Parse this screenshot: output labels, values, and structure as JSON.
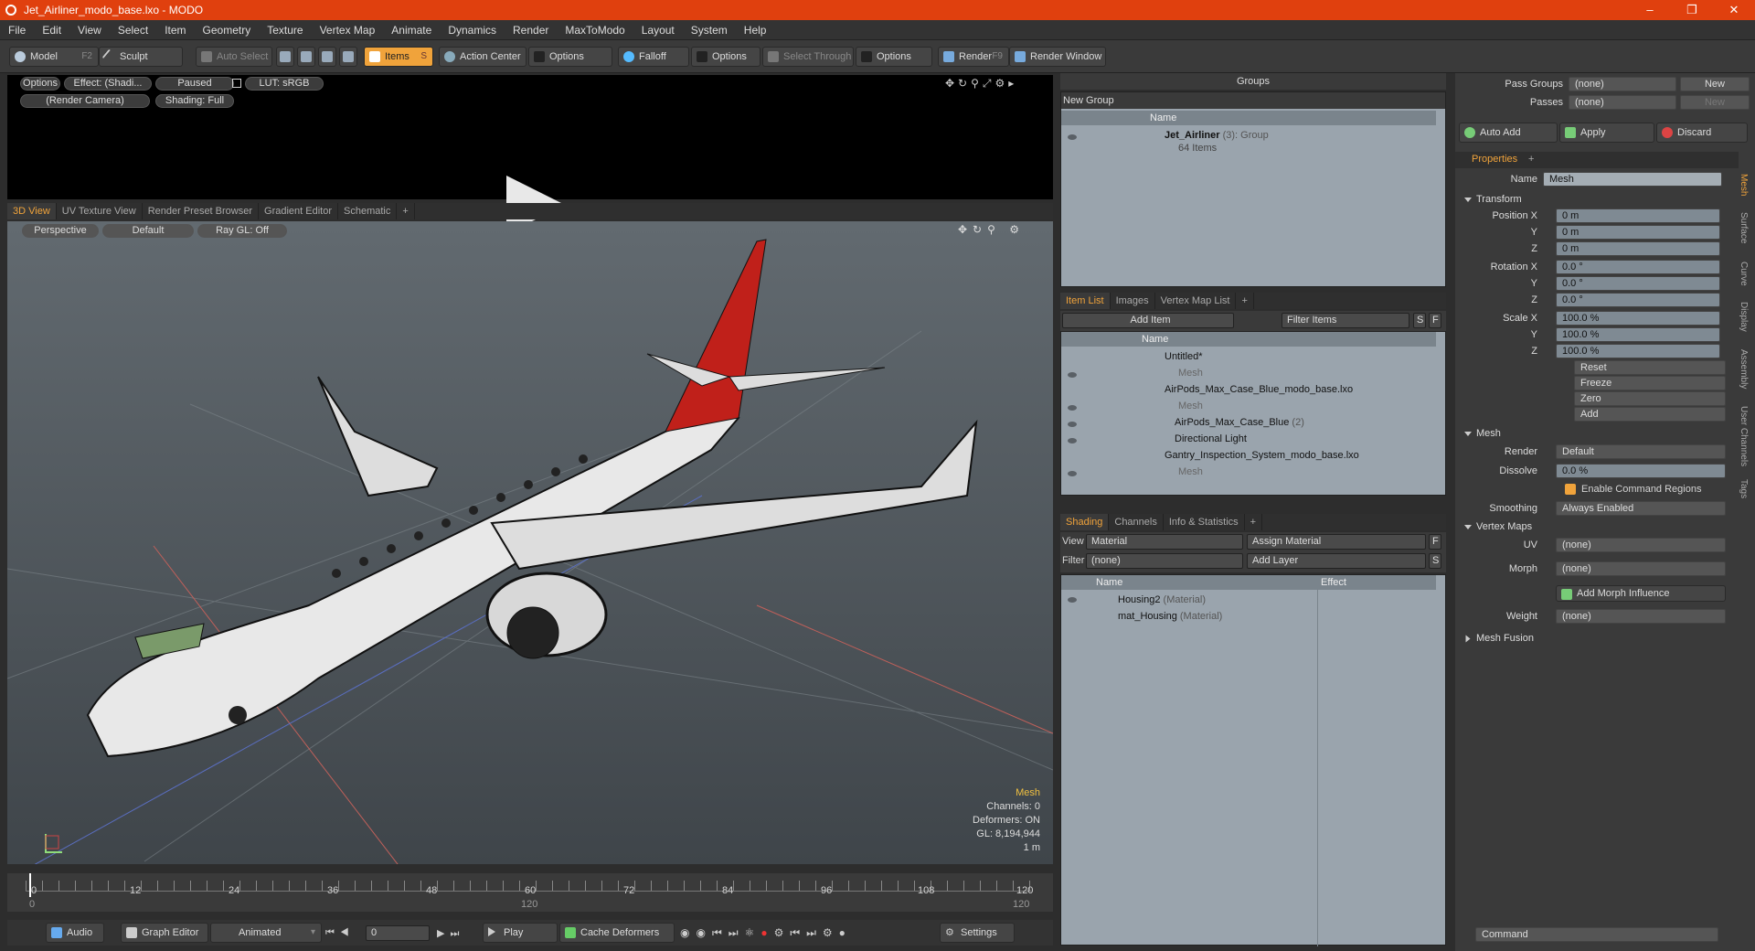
{
  "window": {
    "title": "Jet_Airliner_modo_base.lxo - MODO"
  },
  "menu": [
    "File",
    "Edit",
    "View",
    "Select",
    "Item",
    "Geometry",
    "Texture",
    "Vertex Map",
    "Animate",
    "Dynamics",
    "Render",
    "MaxToModo",
    "Layout",
    "System",
    "Help"
  ],
  "toolbar": {
    "model": "Model",
    "model_key": "F2",
    "sculpt": "Sculpt",
    "auto_select": "Auto Select",
    "items": "Items",
    "items_key": "S",
    "action_center": "Action Center",
    "options1": "Options",
    "falloff": "Falloff",
    "options2": "Options",
    "select_through": "Select Through",
    "options3": "Options",
    "render": "Render",
    "render_key": "F9",
    "render_window": "Render Window"
  },
  "render_preview": {
    "options": "Options",
    "effect": "Effect: (Shadi...",
    "paused": "Paused",
    "lut": "LUT: sRGB",
    "camera": "(Render Camera)",
    "shading": "Shading: Full"
  },
  "viewport_tabs": [
    "3D View",
    "UV Texture View",
    "Render Preset Browser",
    "Gradient Editor",
    "Schematic",
    "+"
  ],
  "viewport": {
    "projection": "Perspective",
    "style": "Default",
    "raygl": "Ray GL: Off",
    "info_title": "Mesh",
    "channels": "Channels: 0",
    "deformers": "Deformers: ON",
    "gl": "GL: 8,194,944",
    "scale": "1 m"
  },
  "timeline": {
    "ticks_top": [
      "0",
      "12",
      "24",
      "36",
      "48",
      "60",
      "72",
      "84",
      "96",
      "108",
      "120"
    ],
    "ticks_bottom": [
      "0",
      "120",
      "120"
    ]
  },
  "bottombar": {
    "audio": "Audio",
    "graph_editor": "Graph Editor",
    "animated": "Animated",
    "frame": "0",
    "play": "Play",
    "cache_deformers": "Cache Deformers",
    "settings": "Settings"
  },
  "groups": {
    "header": "Groups",
    "new_group": "New Group",
    "col_name": "Name",
    "item_name": "Jet_Airliner",
    "item_count": "(3)",
    "item_type": ": Group",
    "item_sub": "64 Items"
  },
  "item_list": {
    "tabs": [
      "Item List",
      "Images",
      "Vertex Map List",
      "+"
    ],
    "add_item": "Add Item",
    "filter": "Filter Items",
    "s_btn": "S",
    "f_btn": "F",
    "col_name": "Name",
    "rows": [
      {
        "label": "Untitled*",
        "sub": ""
      },
      {
        "label": "Mesh",
        "sub": ""
      },
      {
        "label": "AirPods_Max_Case_Blue_modo_base.lxo",
        "sub": ""
      },
      {
        "label": "Mesh",
        "sub": ""
      },
      {
        "label": "AirPods_Max_Case_Blue",
        "sub": "(2)"
      },
      {
        "label": "Directional Light",
        "sub": ""
      },
      {
        "label": "Gantry_Inspection_System_modo_base.lxo",
        "sub": ""
      },
      {
        "label": "Mesh",
        "sub": ""
      }
    ]
  },
  "shading": {
    "tabs": [
      "Shading",
      "Channels",
      "Info & Statistics",
      "+"
    ],
    "view_label": "View",
    "view_value": "Material",
    "assign": "Assign Material",
    "f_btn": "F",
    "filter_label": "Filter",
    "filter_value": "(none)",
    "add_layer": "Add Layer",
    "s_btn": "S",
    "col_name": "Name",
    "col_effect": "Effect",
    "rows": [
      {
        "label": "Housing2",
        "sub": "(Material)"
      },
      {
        "label": "mat_Housing",
        "sub": "(Material)"
      }
    ]
  },
  "props_top": {
    "pass_groups": "Pass Groups",
    "pass_groups_val": "(none)",
    "new1": "New",
    "passes": "Passes",
    "passes_val": "(none)",
    "new2": "New",
    "auto_add": "Auto Add",
    "apply": "Apply",
    "discard": "Discard"
  },
  "properties": {
    "tab": "Properties",
    "plus": "+",
    "name_label": "Name",
    "name_value": "Mesh",
    "transform": "Transform",
    "position": [
      {
        "label": "Position X",
        "value": "0 m"
      },
      {
        "label": "Y",
        "value": "0 m"
      },
      {
        "label": "Z",
        "value": "0 m"
      }
    ],
    "rotation": [
      {
        "label": "Rotation X",
        "value": "0.0 °"
      },
      {
        "label": "Y",
        "value": "0.0 °"
      },
      {
        "label": "Z",
        "value": "0.0 °"
      }
    ],
    "scale": [
      {
        "label": "Scale X",
        "value": "100.0 %"
      },
      {
        "label": "Y",
        "value": "100.0 %"
      },
      {
        "label": "Z",
        "value": "100.0 %"
      }
    ],
    "actions": [
      "Reset",
      "Freeze",
      "Zero",
      "Add"
    ],
    "mesh": "Mesh",
    "render_label": "Render",
    "render_value": "Default",
    "dissolve_label": "Dissolve",
    "dissolve_value": "0.0 %",
    "enable_cmd": "Enable Command Regions",
    "smoothing_label": "Smoothing",
    "smoothing_value": "Always Enabled",
    "vertex_maps": "Vertex Maps",
    "uv_label": "UV",
    "uv_value": "(none)",
    "morph_label": "Morph",
    "morph_value": "(none)",
    "add_morph": "Add Morph Influence",
    "weight_label": "Weight",
    "weight_value": "(none)",
    "mesh_fusion": "Mesh Fusion"
  },
  "side_tabs": [
    "Mesh",
    "Surface",
    "Curve",
    "Display",
    "Assembly",
    "User Channels",
    "Tags"
  ],
  "command": {
    "placeholder": "Command"
  }
}
